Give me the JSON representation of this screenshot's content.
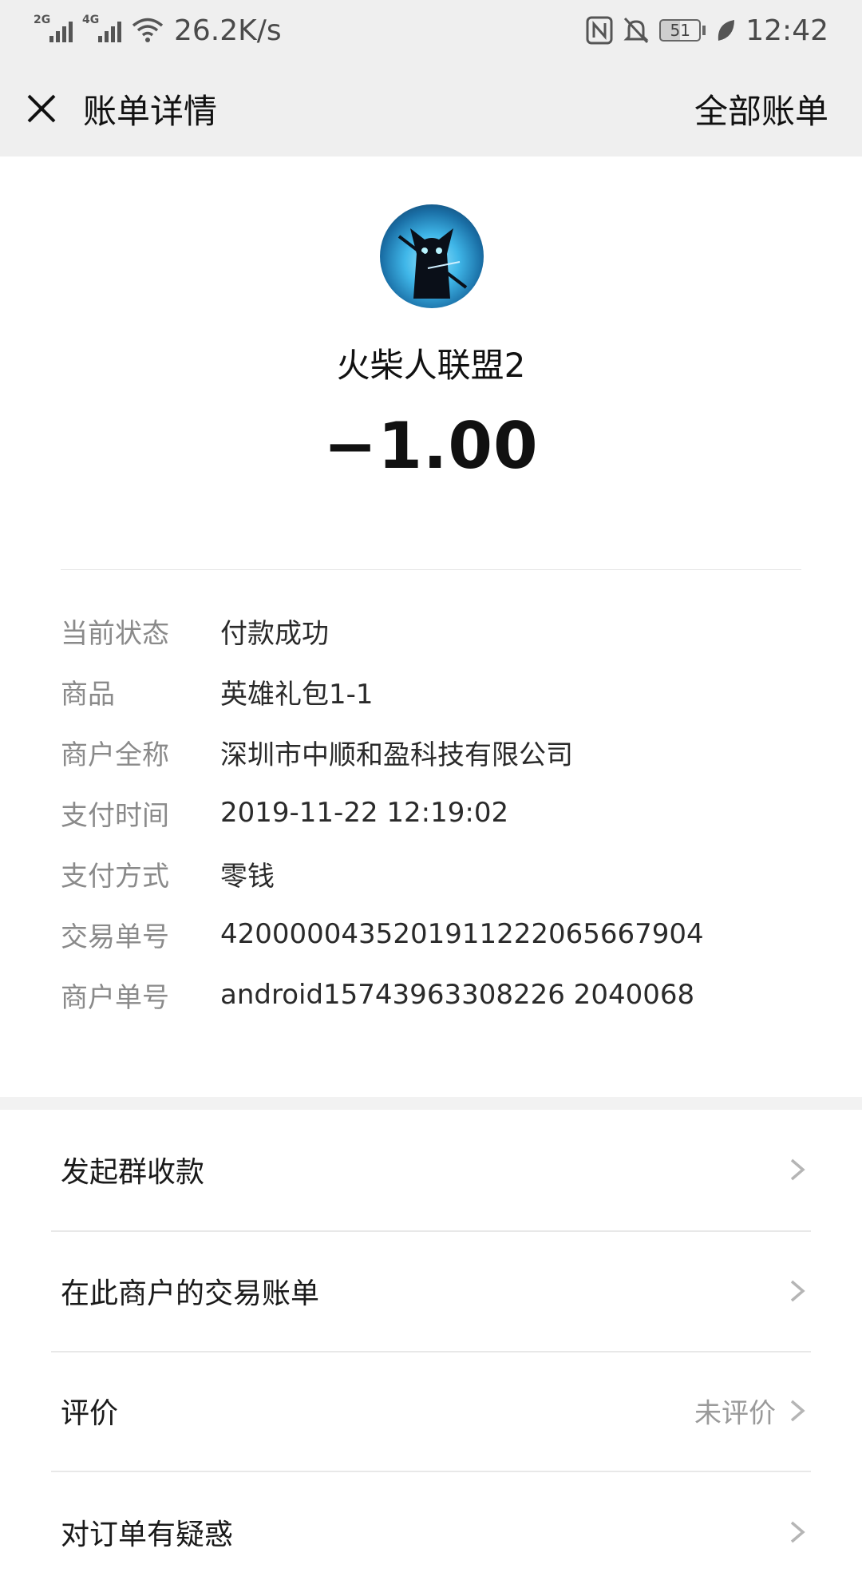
{
  "status_bar": {
    "net1": "2G",
    "net2": "4G",
    "speed": "26.2K/s",
    "battery": "51",
    "time": "12:42",
    "icons": [
      "signal-icon",
      "wifi-icon",
      "nfc-icon",
      "mute-icon",
      "battery-icon",
      "leaf-icon"
    ]
  },
  "nav": {
    "title": "账单详情",
    "all_bills": "全部账单",
    "close_icon": "close-icon"
  },
  "header": {
    "merchant_name": "火柴人联盟2",
    "amount": "−1.00"
  },
  "details": [
    {
      "label": "当前状态",
      "value": "付款成功"
    },
    {
      "label": "商品",
      "value": "英雄礼包1-1"
    },
    {
      "label": "商户全称",
      "value": "深圳市中顺和盈科技有限公司"
    },
    {
      "label": "支付时间",
      "value": "2019-11-22 12:19:02"
    },
    {
      "label": "支付方式",
      "value": "零钱"
    },
    {
      "label": "交易单号",
      "value": "4200000435201911222065667904"
    },
    {
      "label": "商户单号",
      "value": "android15743963308226 2040068"
    }
  ],
  "menu": [
    {
      "label": "发起群收款",
      "value": ""
    },
    {
      "label": "在此商户的交易账单",
      "value": ""
    },
    {
      "label": "评价",
      "value": "未评价"
    },
    {
      "label": "对订单有疑惑",
      "value": ""
    }
  ],
  "colors": {
    "bar_bg": "#efefef",
    "label_gray": "#8a8a8a",
    "text_dark": "#1a1a1a"
  }
}
